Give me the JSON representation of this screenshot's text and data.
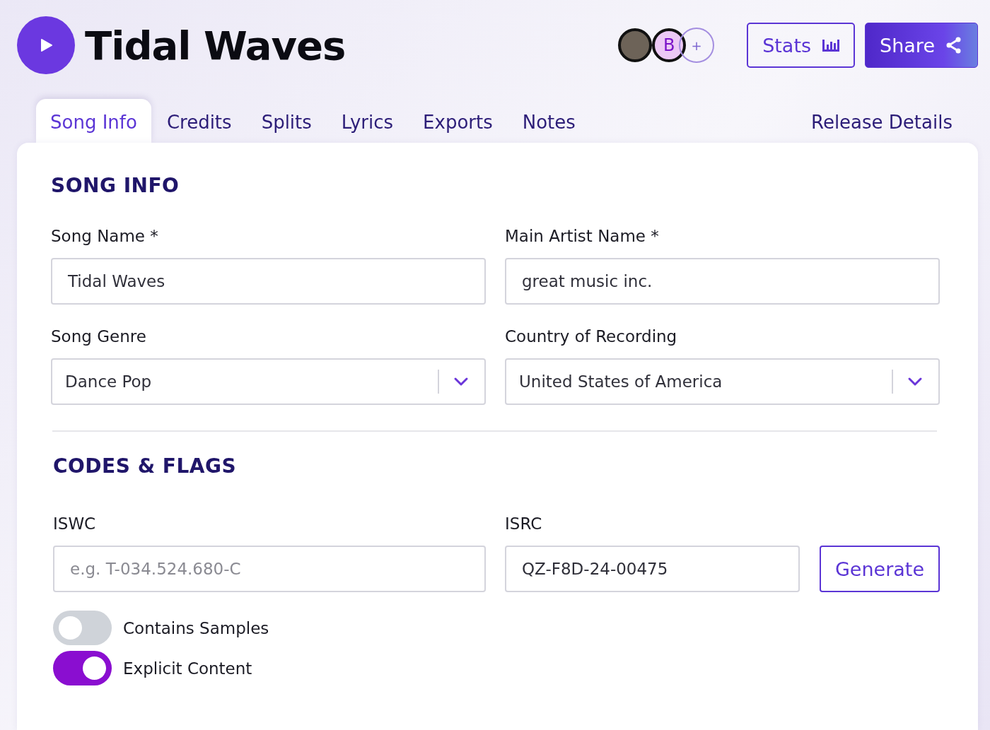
{
  "header": {
    "title": "Tidal Waves",
    "avatars": [
      {
        "kind": "photo"
      },
      {
        "kind": "initial",
        "initial": "B"
      }
    ],
    "add_label": "+",
    "buttons": [
      {
        "kind": "outline",
        "label": "Stats"
      },
      {
        "kind": "primary",
        "label": "Share"
      }
    ]
  },
  "tabs": [
    {
      "label": "Song Info",
      "selected": true
    },
    {
      "label": "Credits",
      "selected": false
    },
    {
      "label": "Splits",
      "selected": false
    },
    {
      "label": "Lyrics",
      "selected": false
    },
    {
      "label": "Exports",
      "selected": false
    },
    {
      "label": "Notes",
      "selected": false
    }
  ],
  "extra_tab": {
    "label": "Release Details"
  },
  "song_info": {
    "heading": "SONG INFO",
    "fields": [
      {
        "kind": "text",
        "label": "Song Name *",
        "value": "Tidal Waves"
      },
      {
        "kind": "text",
        "label": "Main Artist Name *",
        "value": "great music inc."
      },
      {
        "kind": "select",
        "label": "Song Genre",
        "value": "Dance Pop"
      },
      {
        "kind": "select",
        "label": "Country of Recording",
        "value": "United States of America"
      }
    ]
  },
  "codes": {
    "heading": "CODES & FLAGS",
    "iswc": {
      "label": "ISWC",
      "placeholder": "e.g. T-034.524.680-C"
    },
    "isrc": {
      "label": "ISRC",
      "value": "QZ-F8D-24-00475",
      "button": "Generate"
    },
    "toggles": [
      {
        "label": "Contains Samples",
        "on": false
      },
      {
        "label": "Explicit Content",
        "on": true
      }
    ]
  }
}
